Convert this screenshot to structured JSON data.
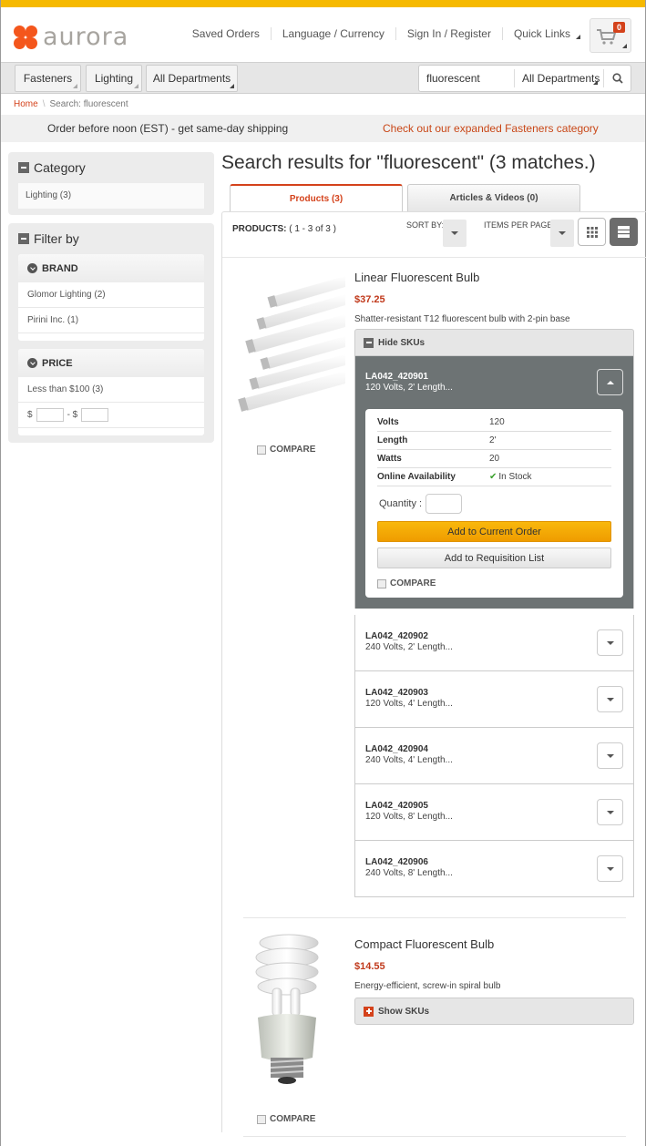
{
  "brand": {
    "name": "aurora",
    "accent": "#f4561c",
    "topbar_color": "#f6b900"
  },
  "header": {
    "links": [
      "Saved Orders",
      "Language / Currency",
      "Sign In / Register",
      "Quick Links"
    ],
    "cart_count": "0",
    "cart_icon": "shopping-cart-icon"
  },
  "nav": {
    "departments": [
      "Fasteners",
      "Lighting",
      "All Departments"
    ],
    "search": {
      "value": "fluorescent",
      "placeholder": "",
      "scope": "All Departments",
      "icon": "search-icon"
    }
  },
  "breadcrumb": {
    "home": "Home",
    "sep": "\\",
    "current": "Search: fluorescent"
  },
  "promo": {
    "left": "Order before noon (EST) - get same-day shipping",
    "right": "Check out our expanded Fasteners category"
  },
  "sidebar": {
    "category": {
      "title": "Category",
      "items": [
        "Lighting (3)"
      ]
    },
    "filter": {
      "title": "Filter by",
      "brand": {
        "title": "BRAND",
        "items": [
          "Glomor Lighting (2)",
          "Pirini Inc. (1)"
        ]
      },
      "price": {
        "title": "PRICE",
        "items": [
          "Less than $100 (3)"
        ],
        "from_label": "$",
        "to_label": "- $"
      }
    }
  },
  "main": {
    "title": "Search results for \"fluorescent\" (3 matches.)",
    "tabs": [
      {
        "label": "Products (3)",
        "active": true
      },
      {
        "label": "Articles & Videos (0)",
        "active": false
      }
    ],
    "toolbar": {
      "count_label": "PRODUCTS:",
      "count_value": "( 1 - 3 of 3 )",
      "sort_label": "SORT BY:",
      "ipp_label": "ITEMS PER PAGE:",
      "view_mode": "list"
    },
    "products": [
      {
        "name": "Linear Fluorescent Bulb",
        "price": "$37.25",
        "description": "Shatter-resistant T12 fluorescent bulb with 2-pin base",
        "compare_label": "COMPARE",
        "sku_toggle_label": "Hide SKUs",
        "expanded_sku": {
          "id": "LA042_420901",
          "summary": "120 Volts, 2' Length...",
          "attributes": [
            {
              "name": "Volts",
              "value": "120"
            },
            {
              "name": "Length",
              "value": "2'"
            },
            {
              "name": "Watts",
              "value": "20"
            },
            {
              "name": "Online Availability",
              "value": "In Stock"
            }
          ],
          "quantity_label": "Quantity :",
          "quantity_value": "",
          "add_order_label": "Add to Current Order",
          "add_req_label": "Add to Requisition List",
          "compare_label": "COMPARE"
        },
        "skus": [
          {
            "id": "LA042_420902",
            "summary": "240 Volts, 2' Length..."
          },
          {
            "id": "LA042_420903",
            "summary": "120 Volts, 4' Length..."
          },
          {
            "id": "LA042_420904",
            "summary": "240 Volts, 4' Length..."
          },
          {
            "id": "LA042_420905",
            "summary": "120 Volts, 8' Length..."
          },
          {
            "id": "LA042_420906",
            "summary": "240 Volts, 8' Length..."
          }
        ]
      },
      {
        "name": "Compact Fluorescent Bulb",
        "price": "$14.55",
        "description": "Energy-efficient, screw-in spiral bulb",
        "compare_label": "COMPARE",
        "sku_toggle_label": "Show SKUs"
      }
    ]
  }
}
